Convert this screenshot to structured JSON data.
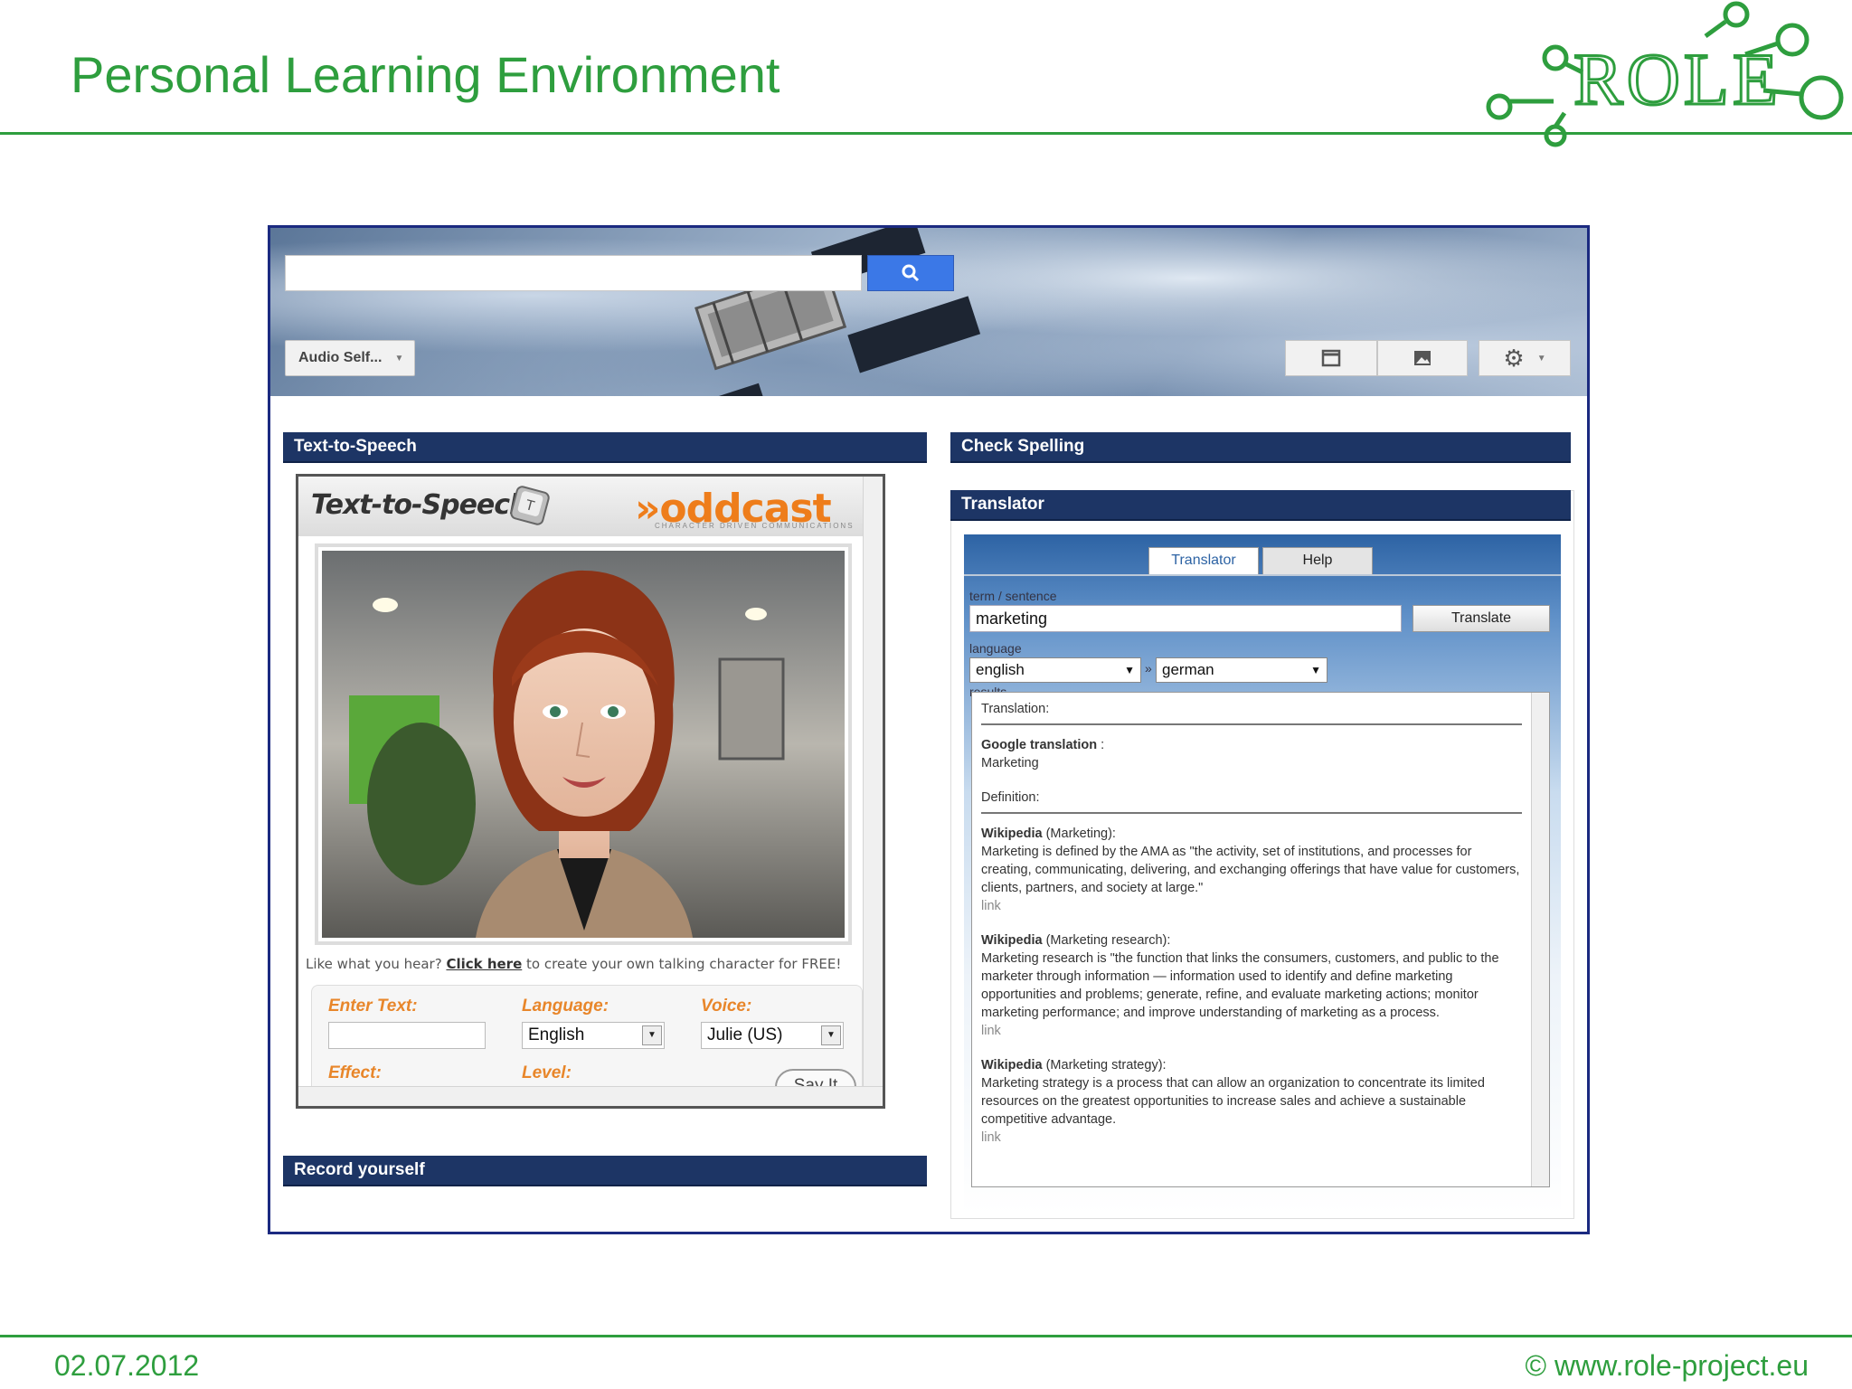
{
  "slide": {
    "title": "Personal Learning Environment",
    "footer_date": "02.07.2012",
    "footer_copyright": "© www.role-project.eu",
    "logo_text": "ROLE",
    "accent_color": "#2e9e3e"
  },
  "toolbar": {
    "search_placeholder": "",
    "search_icon": "search-icon",
    "dropdown_label": "Audio Self...",
    "layout_icon": "window-icon",
    "image_icon": "image-icon",
    "settings_icon": "gear-icon"
  },
  "widgets": {
    "tts": {
      "bar_title": "Text-to-Speech",
      "app_title": "Text-to-Speech",
      "badge_letter": "T",
      "brand": "»oddcast",
      "brand_tagline": "CHARACTER DRIVEN COMMUNICATIONS",
      "promo_before": "Like what you hear? ",
      "promo_link": "Click here",
      "promo_after": " to create your own talking character for FREE!",
      "enter_text_label": "Enter Text:",
      "enter_text_value": "",
      "language_label": "Language:",
      "language_value": "English",
      "voice_label": "Voice:",
      "voice_value": "Julie (US)",
      "effect_label": "Effect:",
      "level_label": "Level:",
      "say_button": "Say It"
    },
    "spelling": {
      "bar_title": "Check Spelling"
    },
    "record": {
      "bar_title": "Record yourself"
    },
    "translator": {
      "bar_title": "Translator",
      "tabs": [
        {
          "label": "Translator",
          "active": true
        },
        {
          "label": "Help",
          "active": false
        }
      ],
      "term_label": "term / sentence",
      "term_value": "marketing",
      "translate_button": "Translate",
      "language_label": "language",
      "from_language": "english",
      "arrow": "»",
      "to_language": "german",
      "results_label": "results",
      "results": {
        "translation_heading": "Translation:",
        "google_label": "Google translation",
        "google_suffix": " :",
        "google_value": "Marketing",
        "definition_heading": "Definition:",
        "entries": [
          {
            "source": "Wikipedia",
            "topic": " (Marketing):",
            "text": "Marketing is defined by the AMA as \"the activity, set of institutions, and processes for creating, communicating, delivering, and exchanging offerings that have value for customers, clients, partners, and society at large.\"",
            "link": "link"
          },
          {
            "source": "Wikipedia",
            "topic": " (Marketing research):",
            "text": "Marketing research is \"the function that links the consumers, customers, and public to the marketer through information — information used to identify and define marketing opportunities and problems; generate, refine, and evaluate marketing actions; monitor marketing performance; and improve understanding of marketing as a process.",
            "link": "link"
          },
          {
            "source": "Wikipedia",
            "topic": " (Marketing strategy):",
            "text": "Marketing strategy is a process that can allow an organization to concentrate its limited resources on the greatest opportunities to increase sales and achieve a sustainable competitive advantage.",
            "link": "link"
          }
        ]
      }
    }
  }
}
